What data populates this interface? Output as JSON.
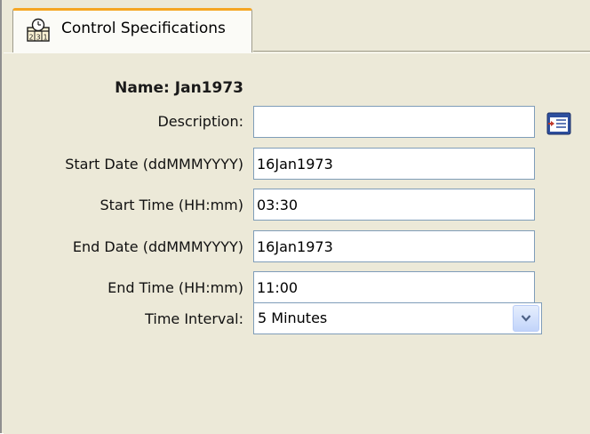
{
  "tab": {
    "label": "Control Specifications",
    "icon": "calendar-clock-icon",
    "accent_color": "#f5a623"
  },
  "form": {
    "name_label": "Name:",
    "name_value": "Jan1973",
    "description": {
      "label": "Description:",
      "value": ""
    },
    "start_date": {
      "label": "Start Date (ddMMMYYYY)",
      "value": "16Jan1973"
    },
    "start_time": {
      "label": "Start Time (HH:mm)",
      "value": "03:30"
    },
    "end_date": {
      "label": "End Date (ddMMMYYYY)",
      "value": "16Jan1973"
    },
    "end_time": {
      "label": "End Time (HH:mm)",
      "value": "11:00"
    },
    "time_interval": {
      "label": "Time Interval:",
      "selected": "5 Minutes"
    },
    "description_editor_icon": "text-editor-icon"
  },
  "colors": {
    "panel_background": "#ece9d8",
    "field_border": "#7f9db9"
  }
}
